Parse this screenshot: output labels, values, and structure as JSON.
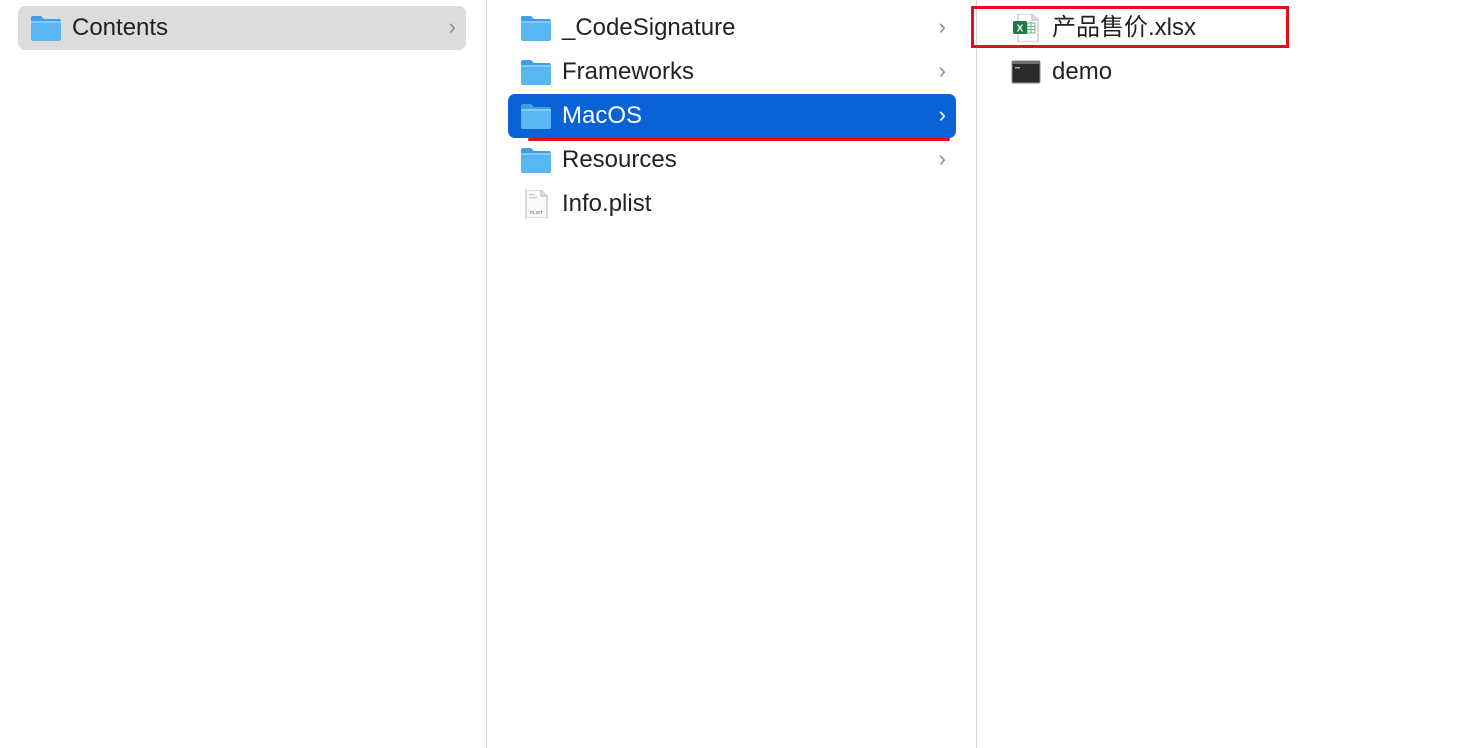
{
  "columns": [
    {
      "items": [
        {
          "label": "Contents",
          "icon": "folder-icon",
          "has_children": true,
          "selected": "inactive"
        }
      ]
    },
    {
      "items": [
        {
          "label": "_CodeSignature",
          "icon": "folder-icon",
          "has_children": true
        },
        {
          "label": "Frameworks",
          "icon": "folder-icon",
          "has_children": true
        },
        {
          "label": "MacOS",
          "icon": "folder-icon",
          "has_children": true,
          "selected": "active"
        },
        {
          "label": "Resources",
          "icon": "folder-icon",
          "has_children": true
        },
        {
          "label": "Info.plist",
          "icon": "plist-file-icon",
          "icon_text": "PLIST",
          "has_children": false
        }
      ]
    },
    {
      "items": [
        {
          "label": "产品售价.xlsx",
          "icon": "excel-file-icon",
          "icon_text": "X",
          "has_children": false
        },
        {
          "label": "demo",
          "icon": "terminal-executable-icon",
          "has_children": false
        }
      ]
    }
  ],
  "chevron": "›",
  "colors": {
    "selection_active": "#0a63d6",
    "selection_inactive": "#dcdcdc",
    "folder": "#5ab6f1",
    "annotation": "#e3101b"
  }
}
